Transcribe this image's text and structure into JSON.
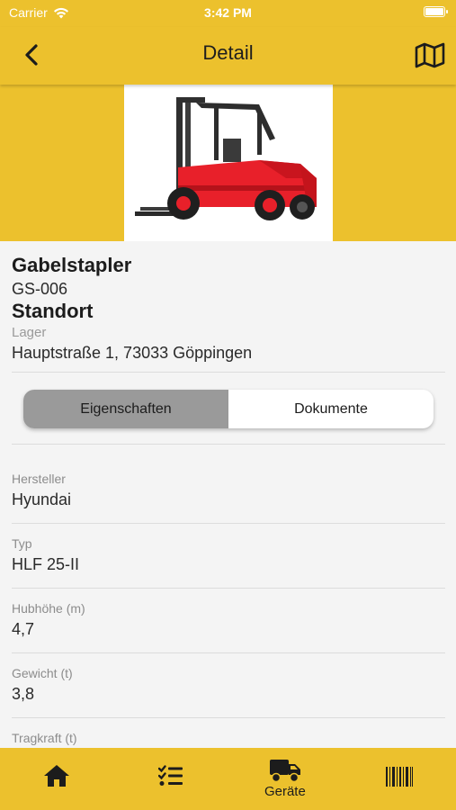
{
  "status_bar": {
    "carrier": "Carrier",
    "time": "3:42 PM"
  },
  "nav": {
    "title": "Detail",
    "back_icon": "chevron-left-icon",
    "map_icon": "map-icon"
  },
  "device": {
    "name": "Gabelstapler",
    "code": "GS-006",
    "location_title": "Standort",
    "location_name": "Lager",
    "address": "Hauptstraße 1, 73033 Göppingen"
  },
  "segments": {
    "items": [
      {
        "label": "Eigenschaften",
        "selected": true
      },
      {
        "label": "Dokumente",
        "selected": false
      }
    ]
  },
  "properties": [
    {
      "label": "Hersteller",
      "value": "Hyundai"
    },
    {
      "label": "Typ",
      "value": "HLF 25-II"
    },
    {
      "label": "Hubhöhe (m)",
      "value": "4,7"
    },
    {
      "label": "Gewicht (t)",
      "value": "3,8"
    },
    {
      "label": "Tragkraft (t)",
      "value": ""
    }
  ],
  "tab_bar": {
    "tabs": [
      {
        "icon": "home-icon",
        "label": ""
      },
      {
        "icon": "checklist-icon",
        "label": ""
      },
      {
        "icon": "truck-icon",
        "label": "Geräte",
        "selected": true
      },
      {
        "icon": "barcode-icon",
        "label": ""
      }
    ]
  },
  "colors": {
    "brand": "#ecc12d",
    "segment_active": "#9a9a9a",
    "forklift_body": "#e8202a"
  }
}
